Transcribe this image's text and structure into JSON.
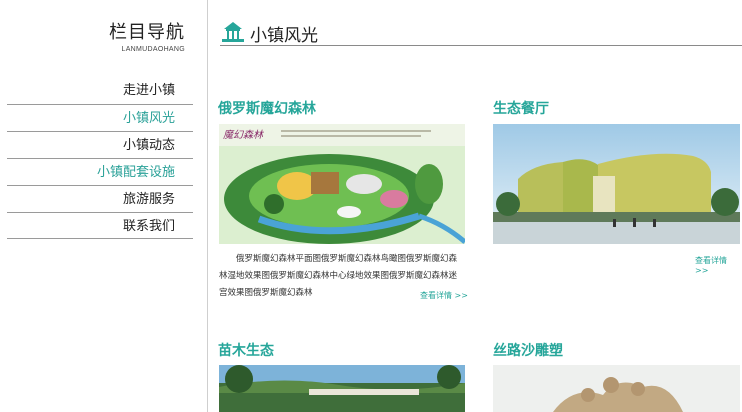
{
  "nav": {
    "title": "栏目导航",
    "subtitle": "LANMUDAOHANG",
    "items": [
      {
        "label": "走进小镇"
      },
      {
        "label": "小镇风光"
      },
      {
        "label": "小镇动态"
      },
      {
        "label": "小镇配套设施"
      },
      {
        "label": "旅游服务"
      },
      {
        "label": "联系我们"
      }
    ]
  },
  "header": {
    "title": "小镇风光"
  },
  "cards": [
    {
      "title": "俄罗斯魔幻森林",
      "image_label": "魔幻森林",
      "description": "俄罗斯魔幻森林平面图俄罗斯魔幻森林鸟瞰图俄罗斯魔幻森林湿地效果图俄罗斯魔幻森林中心绿地效果图俄罗斯魔幻森林迷宫效果图俄罗斯魔幻森林",
      "more": "查看详情 >>"
    },
    {
      "title": "生态餐厅",
      "more": "查看详情 >>"
    },
    {
      "title": "苗木生态"
    },
    {
      "title": "丝路沙雕塑"
    }
  ],
  "colors": {
    "accent": "#26a69a",
    "active_nav": "#2aa198"
  }
}
